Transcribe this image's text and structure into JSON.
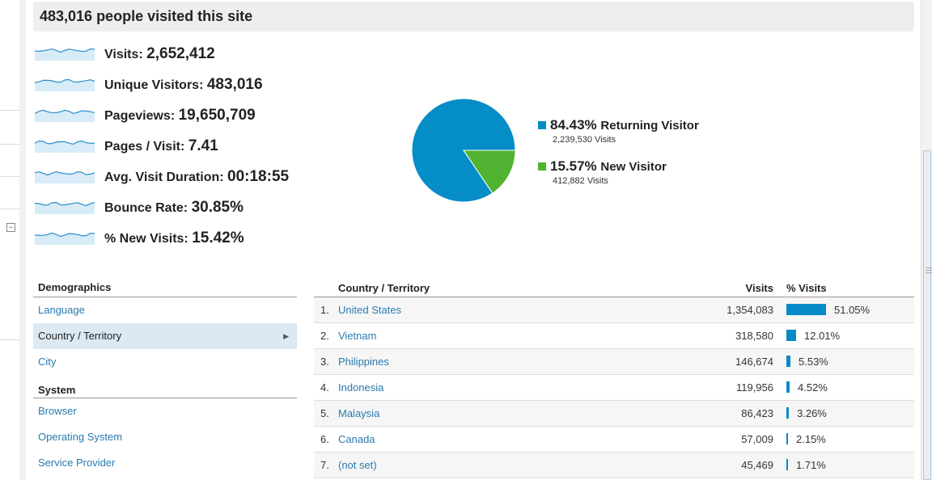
{
  "header": {
    "title": "483,016 people visited this site"
  },
  "metrics": [
    {
      "label": "Visits: ",
      "value": "2,652,412"
    },
    {
      "label": "Unique Visitors: ",
      "value": "483,016"
    },
    {
      "label": "Pageviews: ",
      "value": "19,650,709"
    },
    {
      "label": "Pages / Visit: ",
      "value": "7.41"
    },
    {
      "label": "Avg. Visit Duration: ",
      "value": "00:18:55"
    },
    {
      "label": "Bounce Rate: ",
      "value": "30.85%"
    },
    {
      "label": "% New Visits: ",
      "value": "15.42%"
    }
  ],
  "chart_data": {
    "type": "pie",
    "slices": [
      {
        "name": "Returning Visitor",
        "percent": 84.43,
        "percent_label": "84.43%",
        "visits_label": "2,239,530 Visits",
        "color": "#058dc7"
      },
      {
        "name": "New Visitor",
        "percent": 15.57,
        "percent_label": "15.57%",
        "visits_label": "412,882 Visits",
        "color": "#50b432"
      }
    ]
  },
  "nav": {
    "demographics_title": "Demographics",
    "demographics_items": [
      "Language",
      "Country / Territory",
      "City"
    ],
    "system_title": "System",
    "system_items": [
      "Browser",
      "Operating System",
      "Service Provider"
    ]
  },
  "table": {
    "col_country": "Country / Territory",
    "col_visits": "Visits",
    "col_pct": "% Visits",
    "rows": [
      {
        "rank": "1.",
        "country": "United States",
        "visits": "1,354,083",
        "pct": 51.05,
        "pct_label": "51.05%"
      },
      {
        "rank": "2.",
        "country": "Vietnam",
        "visits": "318,580",
        "pct": 12.01,
        "pct_label": "12.01%"
      },
      {
        "rank": "3.",
        "country": "Philippines",
        "visits": "146,674",
        "pct": 5.53,
        "pct_label": "5.53%"
      },
      {
        "rank": "4.",
        "country": "Indonesia",
        "visits": "119,956",
        "pct": 4.52,
        "pct_label": "4.52%"
      },
      {
        "rank": "5.",
        "country": "Malaysia",
        "visits": "86,423",
        "pct": 3.26,
        "pct_label": "3.26%"
      },
      {
        "rank": "6.",
        "country": "Canada",
        "visits": "57,009",
        "pct": 2.15,
        "pct_label": "2.15%"
      },
      {
        "rank": "7.",
        "country": "(not set)",
        "visits": "45,469",
        "pct": 1.71,
        "pct_label": "1.71%"
      }
    ]
  },
  "icons": {
    "collapse": "collapse-icon",
    "arrow": "chevron-right-icon",
    "sparkline": "sparkline-icon"
  }
}
